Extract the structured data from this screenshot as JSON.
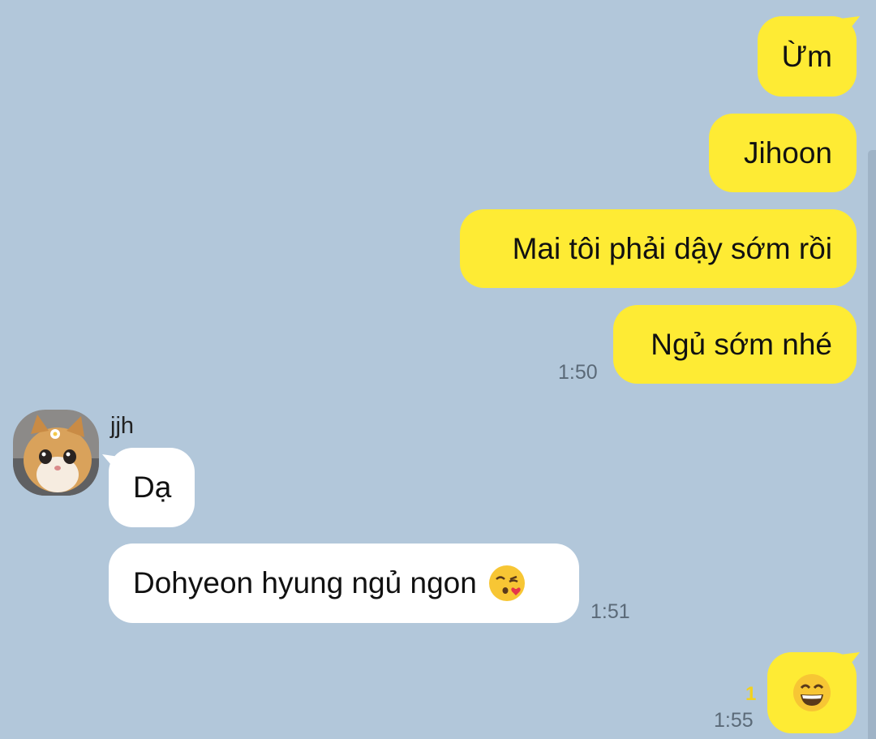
{
  "conversation": {
    "outgoing_group_1": [
      {
        "text": "Ừm"
      },
      {
        "text": "Jihoon"
      },
      {
        "text": "Mai tôi phải dậy sớm rồi"
      },
      {
        "text": "Ngủ sớm nhé"
      }
    ],
    "outgoing_group_1_time": "1:50",
    "incoming": {
      "sender_name": "jjh",
      "messages": [
        {
          "text": "Dạ"
        },
        {
          "text": "Dohyeon hyung ngủ ngon"
        }
      ],
      "time": "1:51",
      "emoji_icon": "face-blowing-kiss-icon"
    },
    "outgoing_group_2": {
      "emoji_icon": "grinning-face-icon",
      "unread_count": "1",
      "time": "1:55"
    }
  },
  "colors": {
    "background": "#B2C7DA",
    "my_bubble": "#FEEB34",
    "their_bubble": "#FFFFFF",
    "timestamp": "#5B6A78",
    "unread": "#F2D21E"
  }
}
